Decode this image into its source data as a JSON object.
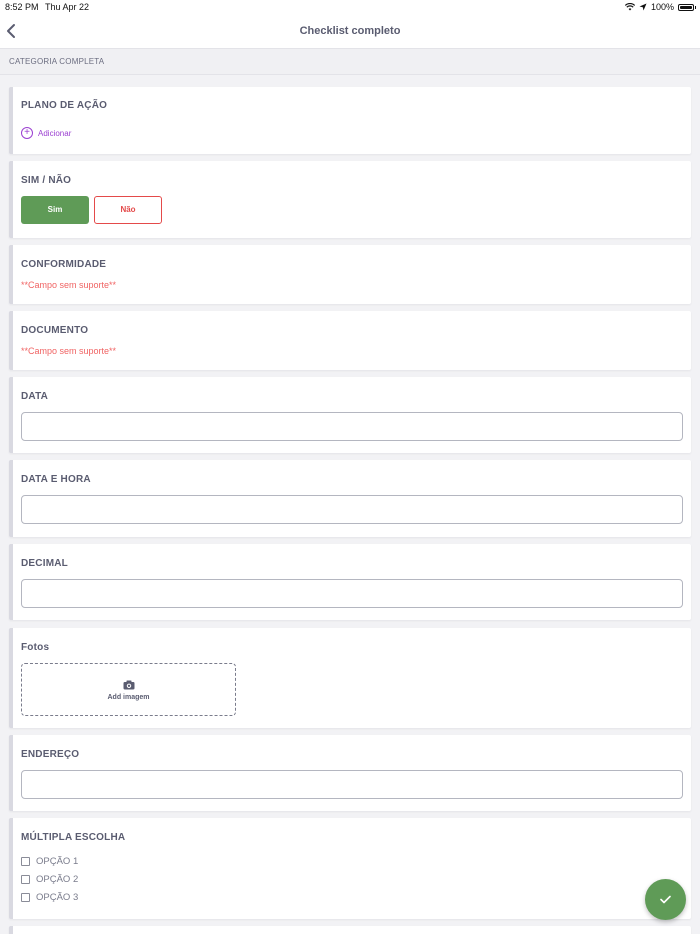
{
  "status_bar": {
    "time": "8:52 PM",
    "date": "Thu Apr 22",
    "battery": "100%"
  },
  "nav": {
    "title": "Checklist completo"
  },
  "section": {
    "title": "CATEGORIA COMPLETA"
  },
  "plano_acao": {
    "label": "PLANO DE AÇÃO",
    "add_label": "Adicionar"
  },
  "sim_nao": {
    "label": "SIM / NÃO",
    "yes_label": "Sim",
    "no_label": "Não",
    "selected": "Sim"
  },
  "conformidade": {
    "label": "CONFORMIDADE",
    "error": "**Campo sem suporte**"
  },
  "documento": {
    "label": "DOCUMENTO",
    "error": "**Campo sem suporte**"
  },
  "data": {
    "label": "DATA",
    "value": ""
  },
  "data_hora": {
    "label": "DATA E HORA",
    "value": ""
  },
  "decimal": {
    "label": "DECIMAL",
    "value": ""
  },
  "fotos": {
    "label": "Fotos",
    "add_label": "Add imagem"
  },
  "endereco": {
    "label": "ENDEREÇO",
    "value": ""
  },
  "multipla": {
    "label": "MÚLTIPLA ESCOLHA",
    "options": [
      {
        "label": "OPÇÃO 1",
        "checked": false
      },
      {
        "label": "OPÇÃO 2",
        "checked": false
      },
      {
        "label": "OPÇÃO 3",
        "checked": false
      }
    ]
  },
  "colors": {
    "accent_green": "#5f9b57",
    "error_red": "#f06464",
    "add_purple": "#9b3fd1"
  },
  "icons": {
    "back": "chevron-left-icon",
    "add": "plus-circle-icon",
    "camera": "camera-icon",
    "confirm": "check-icon"
  }
}
